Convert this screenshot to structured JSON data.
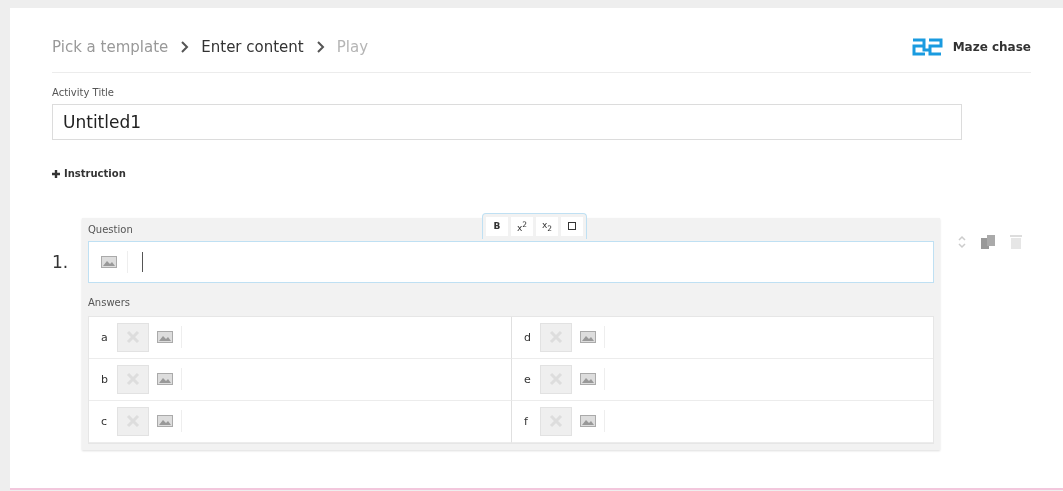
{
  "breadcrumb": [
    {
      "label": "Pick a template",
      "selected": false
    },
    {
      "label": "Enter content",
      "selected": true
    },
    {
      "label": "Play",
      "selected": false
    }
  ],
  "template": {
    "name": "Maze chase"
  },
  "activity_title": {
    "label": "Activity Title",
    "value": "Untitled1"
  },
  "instruction_link": {
    "label": "Instruction"
  },
  "questions": [
    {
      "number": "1.",
      "label": "Question",
      "toolbar": [
        {
          "kind": "text",
          "label": "B"
        },
        {
          "kind": "text",
          "label": "x$^{2}$"
        },
        {
          "kind": "text",
          "label": "x$_{2}$"
        },
        {
          "kind": "symbol"
        }
      ],
      "answers_label": "Answers",
      "answers": [
        {
          "letter": "a",
          "correct": false
        },
        {
          "letter": "b",
          "correct": false
        },
        {
          "letter": "c",
          "correct": false
        },
        {
          "letter": "d",
          "correct": false
        },
        {
          "letter": "e",
          "correct": false
        },
        {
          "letter": "f",
          "correct": false
        }
      ]
    }
  ]
}
